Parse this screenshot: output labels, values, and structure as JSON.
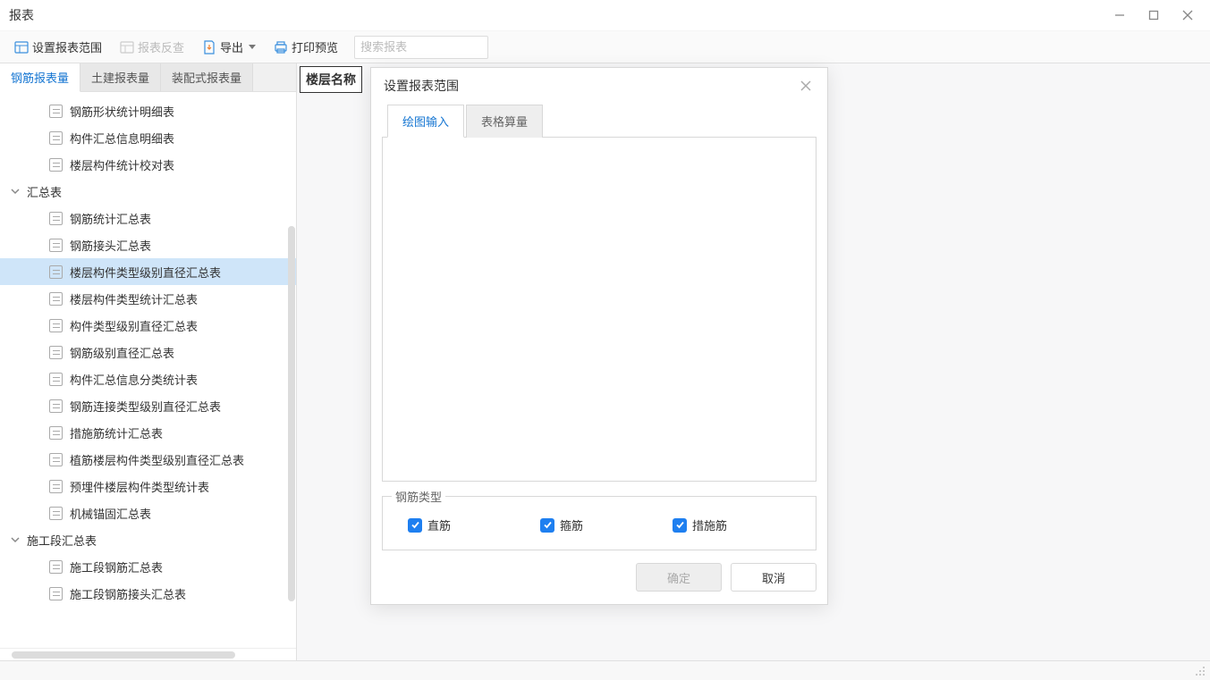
{
  "window": {
    "title": "报表"
  },
  "toolbar": {
    "set_scope": "设置报表范围",
    "report_reverse": "报表反查",
    "export": "导出",
    "print_preview": "打印预览",
    "search_placeholder": "搜索报表"
  },
  "sidebar": {
    "tabs": {
      "rebar": "钢筋报表量",
      "civil": "土建报表量",
      "prefab": "装配式报表量"
    },
    "tree": {
      "items": [
        {
          "label": "钢筋形状统计明细表"
        },
        {
          "label": "构件汇总信息明细表"
        },
        {
          "label": "楼层构件统计校对表"
        }
      ],
      "group1": {
        "label": "汇总表",
        "items": [
          {
            "label": "钢筋统计汇总表"
          },
          {
            "label": "钢筋接头汇总表"
          },
          {
            "label": "楼层构件类型级别直径汇总表"
          },
          {
            "label": "楼层构件类型统计汇总表"
          },
          {
            "label": "构件类型级别直径汇总表"
          },
          {
            "label": "钢筋级别直径汇总表"
          },
          {
            "label": "构件汇总信息分类统计表"
          },
          {
            "label": "钢筋连接类型级别直径汇总表"
          },
          {
            "label": "措施筋统计汇总表"
          },
          {
            "label": "植筋楼层构件类型级别直径汇总表"
          },
          {
            "label": "预埋件楼层构件类型统计表"
          },
          {
            "label": "机械锚固汇总表"
          }
        ]
      },
      "group2": {
        "label": "施工段汇总表",
        "items": [
          {
            "label": "施工段钢筋汇总表"
          },
          {
            "label": "施工段钢筋接头汇总表"
          }
        ]
      }
    }
  },
  "content": {
    "floor_label": "楼层名称"
  },
  "dialog": {
    "title": "设置报表范围",
    "tabs": {
      "draw": "绘图输入",
      "table": "表格算量"
    },
    "fieldset_title": "钢筋类型",
    "checkboxes": {
      "straight": "直筋",
      "stirrup": "箍筋",
      "measure": "措施筋"
    },
    "ok": "确定",
    "cancel": "取消"
  }
}
